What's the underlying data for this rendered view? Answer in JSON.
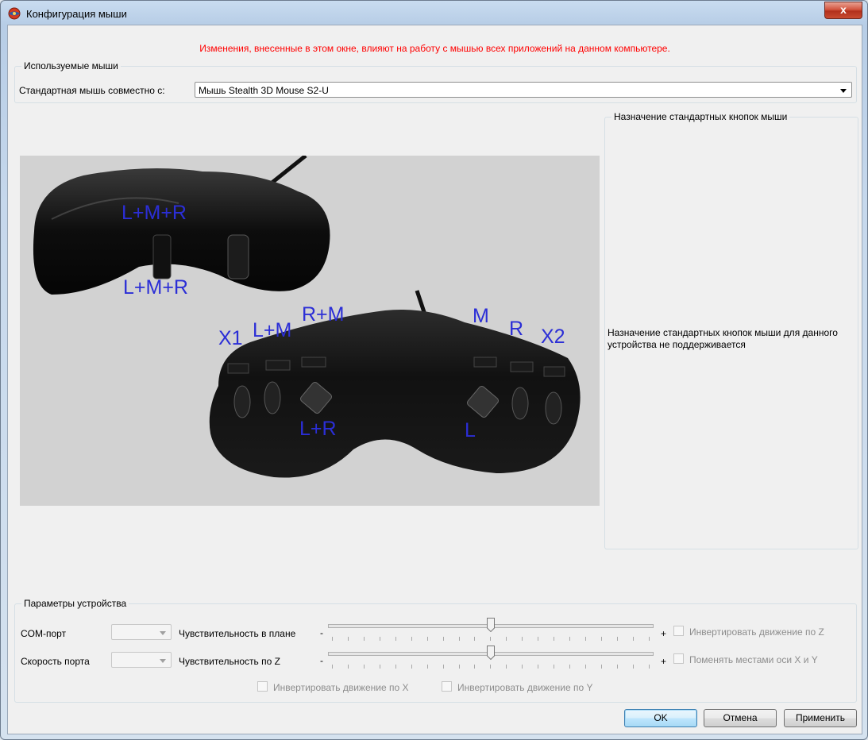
{
  "window": {
    "title": "Конфигурация мыши",
    "close_label": "x"
  },
  "warning": "Изменения, внесенные в этом окне, влияют на работу с мышью всех приложений на данном компьютере.",
  "mice_group": {
    "legend": "Используемые мыши",
    "label": "Стандартная мышь совместно с:",
    "selected": "Мышь Stealth 3D Mouse S2-U"
  },
  "photo_labels": [
    "L+M+R",
    "L+M+R",
    "X1",
    "L+M",
    "R+M",
    "M",
    "R",
    "X2",
    "L+R",
    "L"
  ],
  "buttons_group": {
    "legend": "Назначение стандартных кнопок мыши",
    "message": "Назначение стандартных кнопок мыши для данного устройства не поддерживается"
  },
  "device_group": {
    "legend": "Параметры устройства",
    "com_port_label": "COM-порт",
    "port_speed_label": "Скорость порта",
    "plane_sens_label": "Чувствительность в плане",
    "z_sens_label": "Чувствительность по Z",
    "minus": "-",
    "plus": "+",
    "plane_sens_value": 0.5,
    "z_sens_value": 0.5,
    "invert_z": "Инвертировать движение по Z",
    "swap_xy": "Поменять местами оси X и Y",
    "invert_x": "Инвертировать движение по X",
    "invert_y": "Инвертировать движение по Y"
  },
  "footer": {
    "ok": "OK",
    "cancel": "Отмена",
    "apply": "Применить"
  }
}
